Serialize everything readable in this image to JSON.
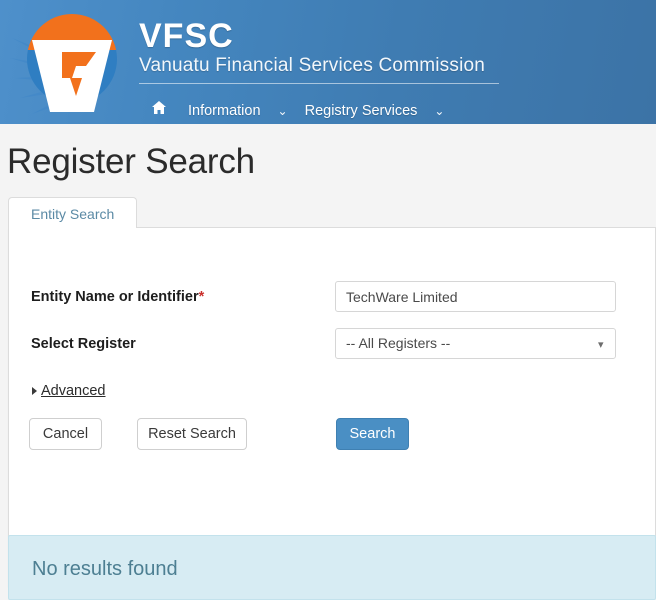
{
  "header": {
    "logo_icon": "vfsc-shield-logo",
    "brand_acronym": "VFSC",
    "brand_full": "Vanuatu Financial Services Commission",
    "colors": {
      "header_blue_left": "#4e90cb",
      "header_blue_right": "#3c73a6",
      "accent_maroon": "#5a2333",
      "accent_rose": "#d8a0ac"
    },
    "nav": {
      "home_icon": "home-icon",
      "items": [
        {
          "label": "Information",
          "caret_icon": "chevron-down-icon"
        },
        {
          "label": "Registry Services",
          "caret_icon": "chevron-down-icon"
        }
      ]
    }
  },
  "page": {
    "title": "Register Search",
    "tabs": [
      {
        "label": "Entity Search",
        "active": true
      }
    ]
  },
  "form": {
    "entity_name": {
      "label": "Entity Name or Identifier",
      "required_marker": "*",
      "value": "TechWare Limited",
      "placeholder": ""
    },
    "select_register": {
      "label": "Select Register",
      "selected": "-- All Registers --",
      "caret_icon": "chevron-down-icon",
      "options": [
        "-- All Registers --"
      ]
    },
    "advanced": {
      "label": "Advanced",
      "triangle_icon": "triangle-right-icon"
    },
    "buttons": {
      "cancel": "Cancel",
      "reset": "Reset Search",
      "search": "Search",
      "search_color": "#4a8fc4"
    }
  },
  "results": {
    "message": "No results found",
    "panel_bg": "#d7ecf3",
    "text_color": "#4d7f92"
  }
}
